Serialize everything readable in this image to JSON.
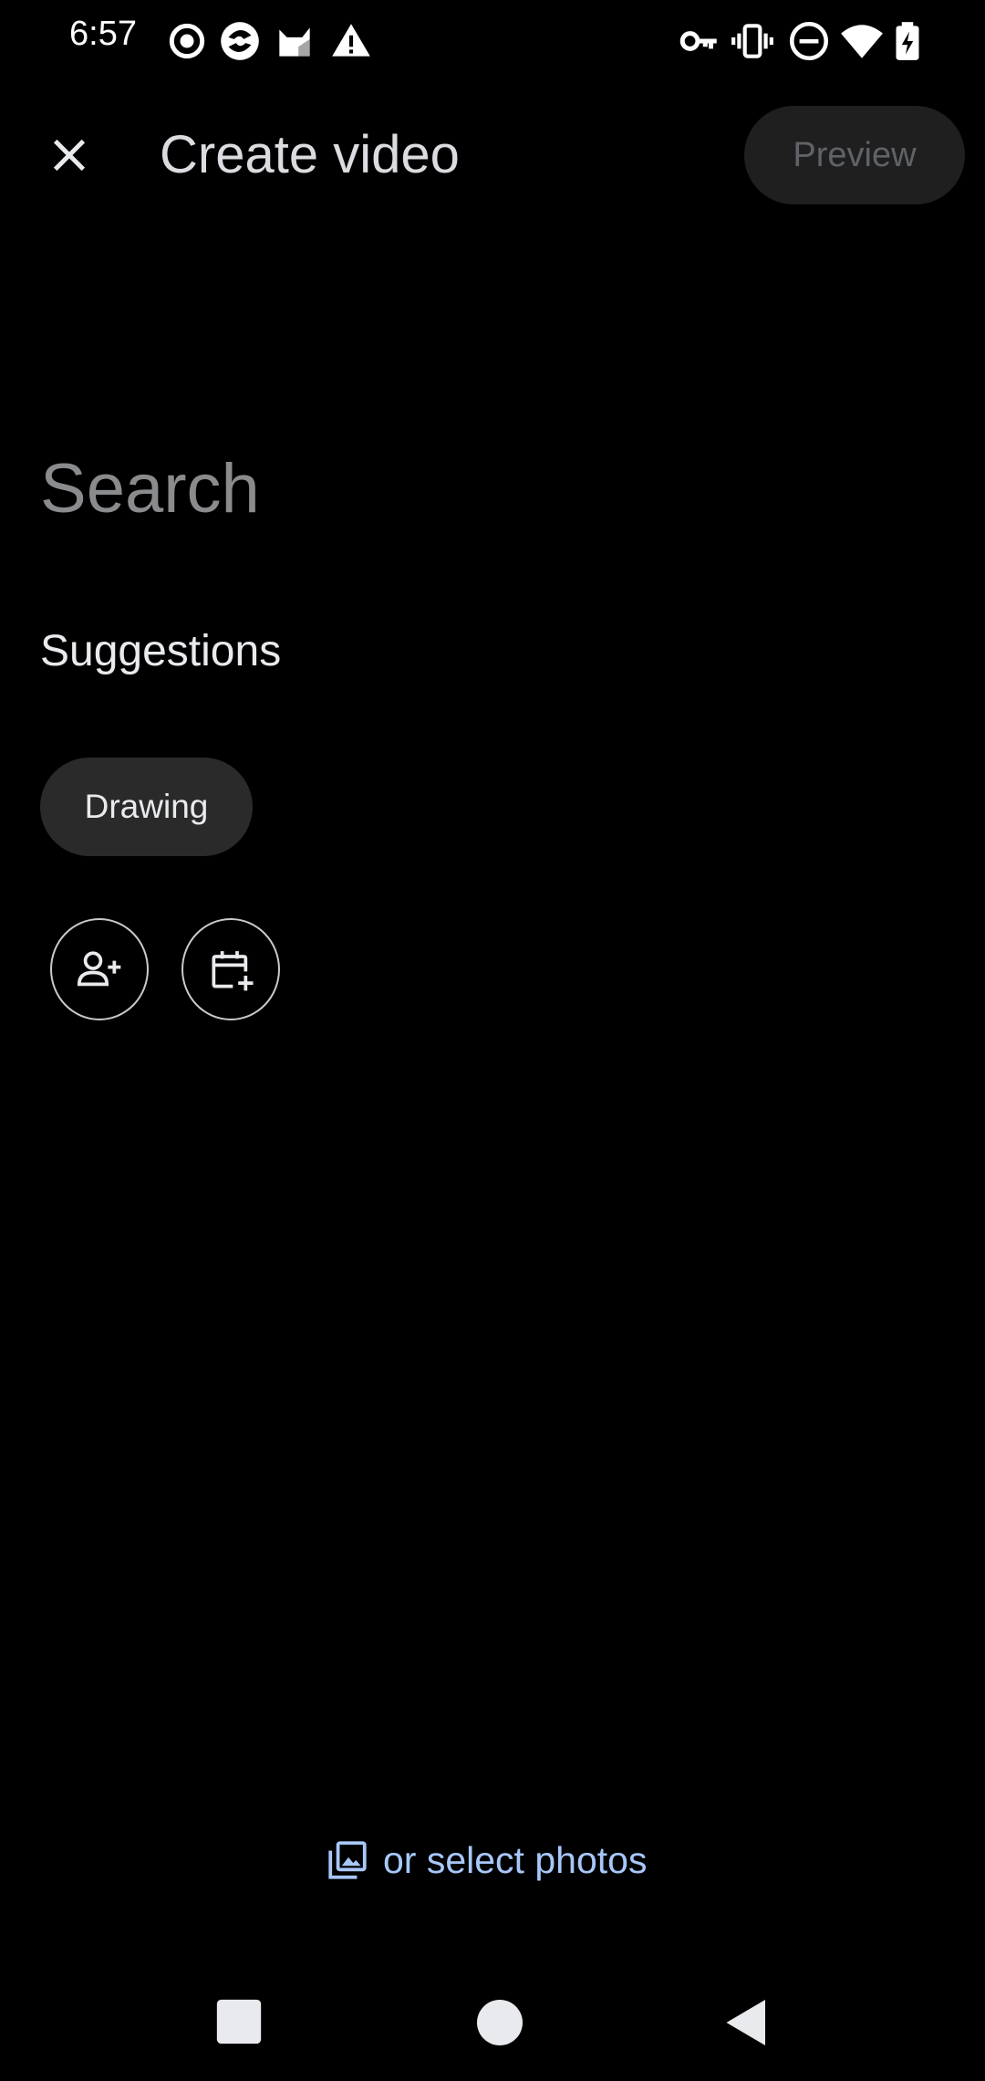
{
  "status_bar": {
    "time": "6:57",
    "left_icons": [
      "record-icon",
      "vpn-app-icon",
      "cat-app-icon",
      "warning-icon"
    ],
    "right_icons": [
      "key-icon",
      "vibrate-icon",
      "do-not-disturb-icon",
      "wifi-icon",
      "battery-charging-icon"
    ]
  },
  "app_bar": {
    "title": "Create video",
    "preview_label": "Preview",
    "close_icon": "close-icon"
  },
  "search": {
    "placeholder": "Search",
    "value": ""
  },
  "suggestions": {
    "heading": "Suggestions",
    "chips": [
      {
        "label": "Drawing"
      }
    ],
    "actions": [
      {
        "icon": "add-person-icon"
      },
      {
        "icon": "add-date-icon"
      }
    ]
  },
  "footer": {
    "select_photos_label": "or select photos",
    "select_photos_icon": "photo-library-icon"
  },
  "nav_bar": {
    "buttons": [
      "recents-button",
      "home-button",
      "back-button"
    ]
  },
  "colors": {
    "background": "#000000",
    "accent_link": "#a8c7fa",
    "chip_background": "#2a2a2a",
    "disabled_button_bg": "#1f1f1f"
  }
}
